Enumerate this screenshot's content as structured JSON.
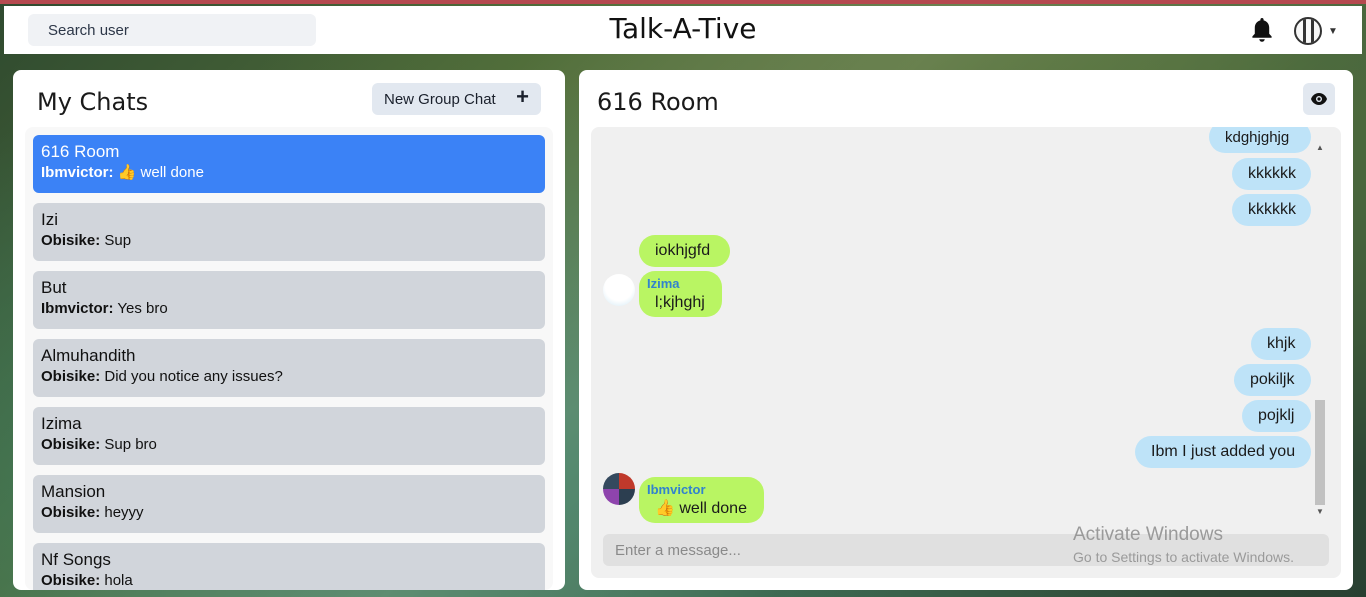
{
  "header": {
    "search_label": "Search user",
    "app_title": "Talk-A-Tive",
    "accent_bar_color": "#b5494f"
  },
  "left": {
    "title": "My Chats",
    "new_group_label": "New Group Chat",
    "new_group_icon": "+",
    "chats": [
      {
        "name": "616 Room",
        "sender": "Ibmvictor:",
        "message": "👍 well done",
        "active": true
      },
      {
        "name": "Izi",
        "sender": "Obisike:",
        "message": "Sup",
        "active": false
      },
      {
        "name": "But",
        "sender": "Ibmvictor:",
        "message": "Yes bro",
        "active": false
      },
      {
        "name": "Almuhandith",
        "sender": "Obisike:",
        "message": "Did you notice any issues?",
        "active": false
      },
      {
        "name": "Izima",
        "sender": "Obisike:",
        "message": "Sup bro",
        "active": false
      },
      {
        "name": "Mansion",
        "sender": "Obisike:",
        "message": "heyyy",
        "active": false
      },
      {
        "name": "Nf Songs",
        "sender": "Obisike:",
        "message": "hola",
        "active": false
      }
    ]
  },
  "room": {
    "title": "616 Room",
    "messages": [
      {
        "text": "kdghjghjg",
        "dir": "out"
      },
      {
        "text": "kkkkkk",
        "dir": "out"
      },
      {
        "text": "kkkkkk",
        "dir": "out"
      },
      {
        "text": "iokhjgfd",
        "dir": "in"
      },
      {
        "sender": "Izima",
        "text": "l;kjhghj",
        "dir": "in"
      },
      {
        "text": "khjk",
        "dir": "out"
      },
      {
        "text": "pokiljk",
        "dir": "out"
      },
      {
        "text": "pojklj",
        "dir": "out"
      },
      {
        "text": "Ibm I just added you",
        "dir": "out"
      },
      {
        "sender": "Ibmvictor",
        "text": "👍 well done",
        "dir": "in"
      }
    ],
    "input_placeholder": "Enter a message..."
  },
  "watermark": {
    "line1": "Activate Windows",
    "line2": "Go to Settings to activate Windows."
  },
  "colors": {
    "active_chat": "#3b82f6",
    "chat_item": "#d1d5db",
    "outgoing_bubble": "#bee3f8",
    "incoming_bubble": "#b9f563",
    "sender_name": "#3182ce"
  }
}
